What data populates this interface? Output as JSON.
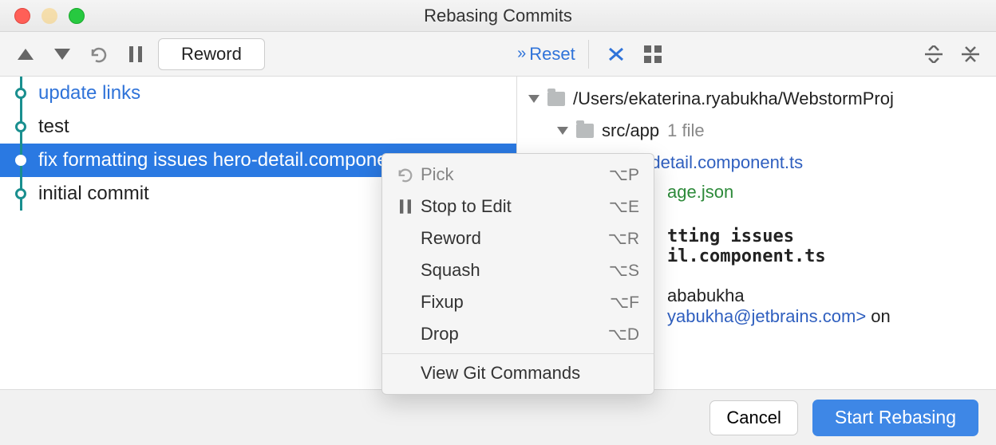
{
  "window": {
    "title": "Rebasing Commits"
  },
  "toolbar": {
    "reword_label": "Reword",
    "reset_label": "Reset"
  },
  "commits": [
    {
      "msg": "update links",
      "link": true,
      "selected": false
    },
    {
      "msg": "test",
      "link": false,
      "selected": false
    },
    {
      "msg": "fix formatting issues hero-detail.component.ts",
      "link": false,
      "selected": true
    },
    {
      "msg": "initial commit",
      "link": false,
      "selected": false
    }
  ],
  "tree": {
    "root_path": "/Users/ekaterina.ryabukha/WebstormProj",
    "folder": "src/app",
    "folder_hint": "1 file",
    "file1": "hero-detail.component.ts",
    "file2_suffix": "age.json"
  },
  "details": {
    "line1_suffix": "tting issues",
    "line2_suffix": "il.component.ts",
    "author_suffix": "ababukha",
    "email_suffix": "yabukha@jetbrains.com>",
    "on_label": " on"
  },
  "context_menu": {
    "items": [
      {
        "icon": "undo",
        "label": "Pick",
        "shortcut": "⌥P",
        "disabled": true
      },
      {
        "icon": "pause",
        "label": "Stop to Edit",
        "shortcut": "⌥E",
        "disabled": false
      },
      {
        "icon": "",
        "label": "Reword",
        "shortcut": "⌥R",
        "disabled": false
      },
      {
        "icon": "",
        "label": "Squash",
        "shortcut": "⌥S",
        "disabled": false
      },
      {
        "icon": "",
        "label": "Fixup",
        "shortcut": "⌥F",
        "disabled": false
      },
      {
        "icon": "",
        "label": "Drop",
        "shortcut": "⌥D",
        "disabled": false
      }
    ],
    "footer_label": "View Git Commands"
  },
  "footer": {
    "cancel_label": "Cancel",
    "start_label": "Start Rebasing"
  }
}
